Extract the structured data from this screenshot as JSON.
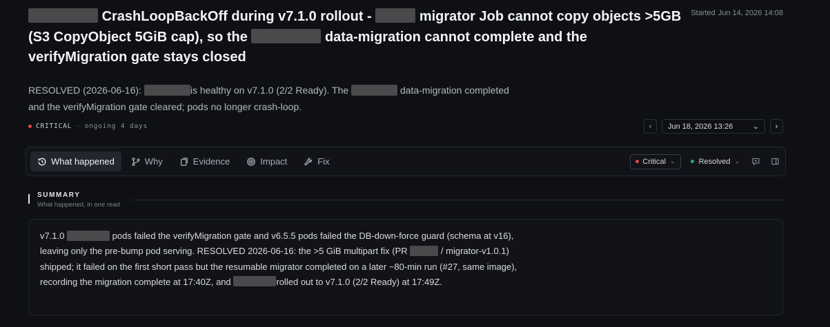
{
  "incident": {
    "title_part1": "CrashLoopBackOff during v7.1.0 rollout -",
    "title_part2": "migrator Job cannot copy objects >5GB (S3 CopyObject 5GiB cap), so the",
    "title_part3": "data-migration cannot complete and the verifyMigration gate stays closed",
    "started_label": "Started",
    "started_at": "Jun 14, 2026 14:08",
    "resolved_part1": "RESOLVED (2026-06-16):",
    "resolved_part2": "is healthy on v7.1.0 (2/2 Ready). The",
    "resolved_part3": "data-migration completed and the verifyMigration gate cleared; pods no longer crash-loop.",
    "severity": "CRITICAL",
    "duration": "ongoing 4 days",
    "snapshot": "Jun 18, 2026 13:26"
  },
  "tabs": [
    {
      "label": "What happened",
      "icon": "history-icon"
    },
    {
      "label": "Why",
      "icon": "git-branch-icon"
    },
    {
      "label": "Evidence",
      "icon": "documents-icon"
    },
    {
      "label": "Impact",
      "icon": "target-icon"
    },
    {
      "label": "Fix",
      "icon": "wrench-icon"
    }
  ],
  "controls": {
    "severity_label": "Critical",
    "status_label": "Resolved"
  },
  "summary": {
    "heading": "SUMMARY",
    "subheading": "What happened, in one read",
    "text_part1": "v7.1.0",
    "text_part2": "pods failed the verifyMigration gate and v6.5.5 pods failed the DB-down-force guard (schema at v16), leaving only the pre-bump pod serving. RESOLVED 2026-06-16: the >5 GiB multipart fix (PR",
    "text_part3": "/ migrator-v1.0.1) shipped; it failed on the first short pass but the resumable migrator completed on a later ~80-min run (#27, same image), recording the migration complete at 17:40Z, and",
    "text_part4": "rolled out to v7.1.0 (2/2 Ready) at 17:49Z."
  },
  "colors": {
    "critical": "#e5484d",
    "resolved": "#30a46c",
    "background": "#0e1014"
  }
}
